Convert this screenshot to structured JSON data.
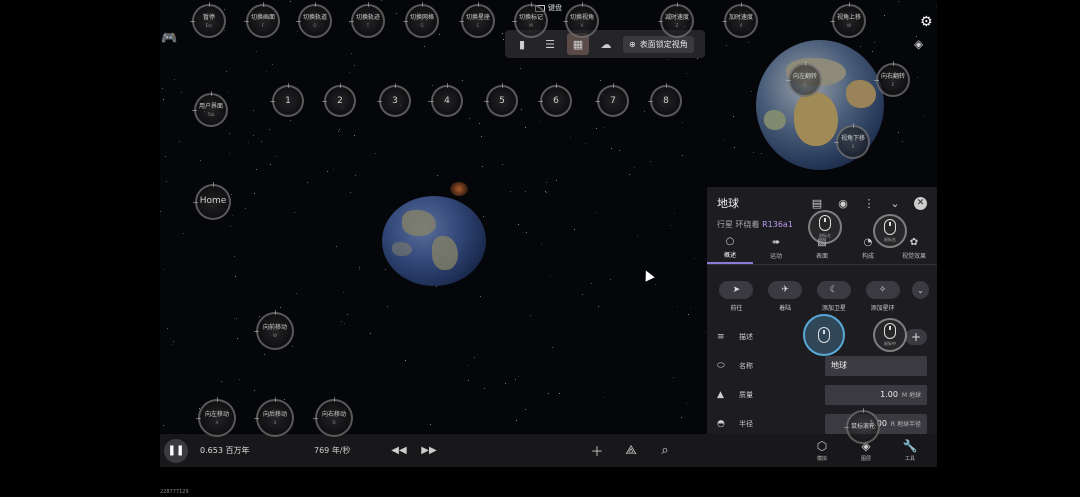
{
  "top_buttons": [
    {
      "label": "暂停",
      "key": "Esc"
    },
    {
      "label": "切换画面",
      "key": "F"
    },
    {
      "label": "切换轨道",
      "key": "O"
    },
    {
      "label": "切换轨迹",
      "key": "T"
    },
    {
      "label": "切换网格",
      "key": "G"
    },
    {
      "label": "切换星座",
      "key": "C"
    },
    {
      "label": "切换标记",
      "key": "M"
    },
    {
      "label": "切换视角",
      "key": "V"
    },
    {
      "label": "减时速度",
      "key": "Z"
    },
    {
      "label": "加时速度",
      "key": "X"
    },
    {
      "label": "视角上移",
      "key": "W"
    }
  ],
  "keyboard_label": "键盘",
  "toolbar": {
    "icons": [
      "flashlight-icon",
      "sliders-icon",
      "grid-icon",
      "cloud-icon"
    ],
    "lock_view_label": "表面锁定视角"
  },
  "left_buttons": [
    {
      "label": "用户界面",
      "key": "Tab"
    },
    {
      "label": "Home",
      "key": ""
    }
  ],
  "number_buttons": [
    "1",
    "2",
    "3",
    "4",
    "5",
    "6",
    "7",
    "8"
  ],
  "move_buttons": [
    {
      "label": "向前移动",
      "key": "W"
    },
    {
      "label": "向左移动",
      "key": "A"
    },
    {
      "label": "向后移动",
      "key": "S"
    },
    {
      "label": "向右移动",
      "key": "D"
    }
  ],
  "globe_buttons": [
    {
      "label": "向左翻转",
      "key": "Q"
    },
    {
      "label": "向右翻转",
      "key": "E"
    },
    {
      "label": "视角下移",
      "key": "S"
    }
  ],
  "panel": {
    "title": "地球",
    "subtitle_prefix": "行星 环绕着",
    "subtitle_link": "R136a1",
    "tabs": [
      {
        "label": "概述",
        "icon": "circle-icon",
        "active": true
      },
      {
        "label": "运动",
        "icon": "motion-icon",
        "active": false
      },
      {
        "label": "表面",
        "icon": "surface-icon",
        "active": false
      },
      {
        "label": "构成",
        "icon": "composition-icon",
        "active": false
      },
      {
        "label": "视觉效果",
        "icon": "palette-icon",
        "active": false
      }
    ],
    "actions": [
      {
        "label": "前往",
        "icon": "send-icon"
      },
      {
        "label": "着陆",
        "icon": "land-icon"
      },
      {
        "label": "添加卫星",
        "icon": "add-satellite-icon"
      },
      {
        "label": "添加星环",
        "icon": "add-ring-icon"
      }
    ],
    "rows": [
      {
        "label": "描述",
        "value": "",
        "unit": ""
      },
      {
        "label": "名称",
        "value": "地球",
        "unit": ""
      },
      {
        "label": "质量",
        "value": "1.00",
        "unit": "M 地球"
      },
      {
        "label": "半径",
        "value": "1.00",
        "unit": "R 地球半径"
      }
    ],
    "ring_labels": {
      "top_left": "鼠标左",
      "top_right": "鼠标右",
      "mid_right": "鼠标中"
    }
  },
  "bottom": {
    "time": "0.653 百万年",
    "speed": "769  年/秒",
    "right_tools": [
      {
        "label": "模拟",
        "icon": "cube-icon"
      },
      {
        "label": "图层",
        "icon": "layers-icon"
      },
      {
        "label": "工具",
        "icon": "wrench-icon"
      }
    ]
  },
  "version": "228777129"
}
